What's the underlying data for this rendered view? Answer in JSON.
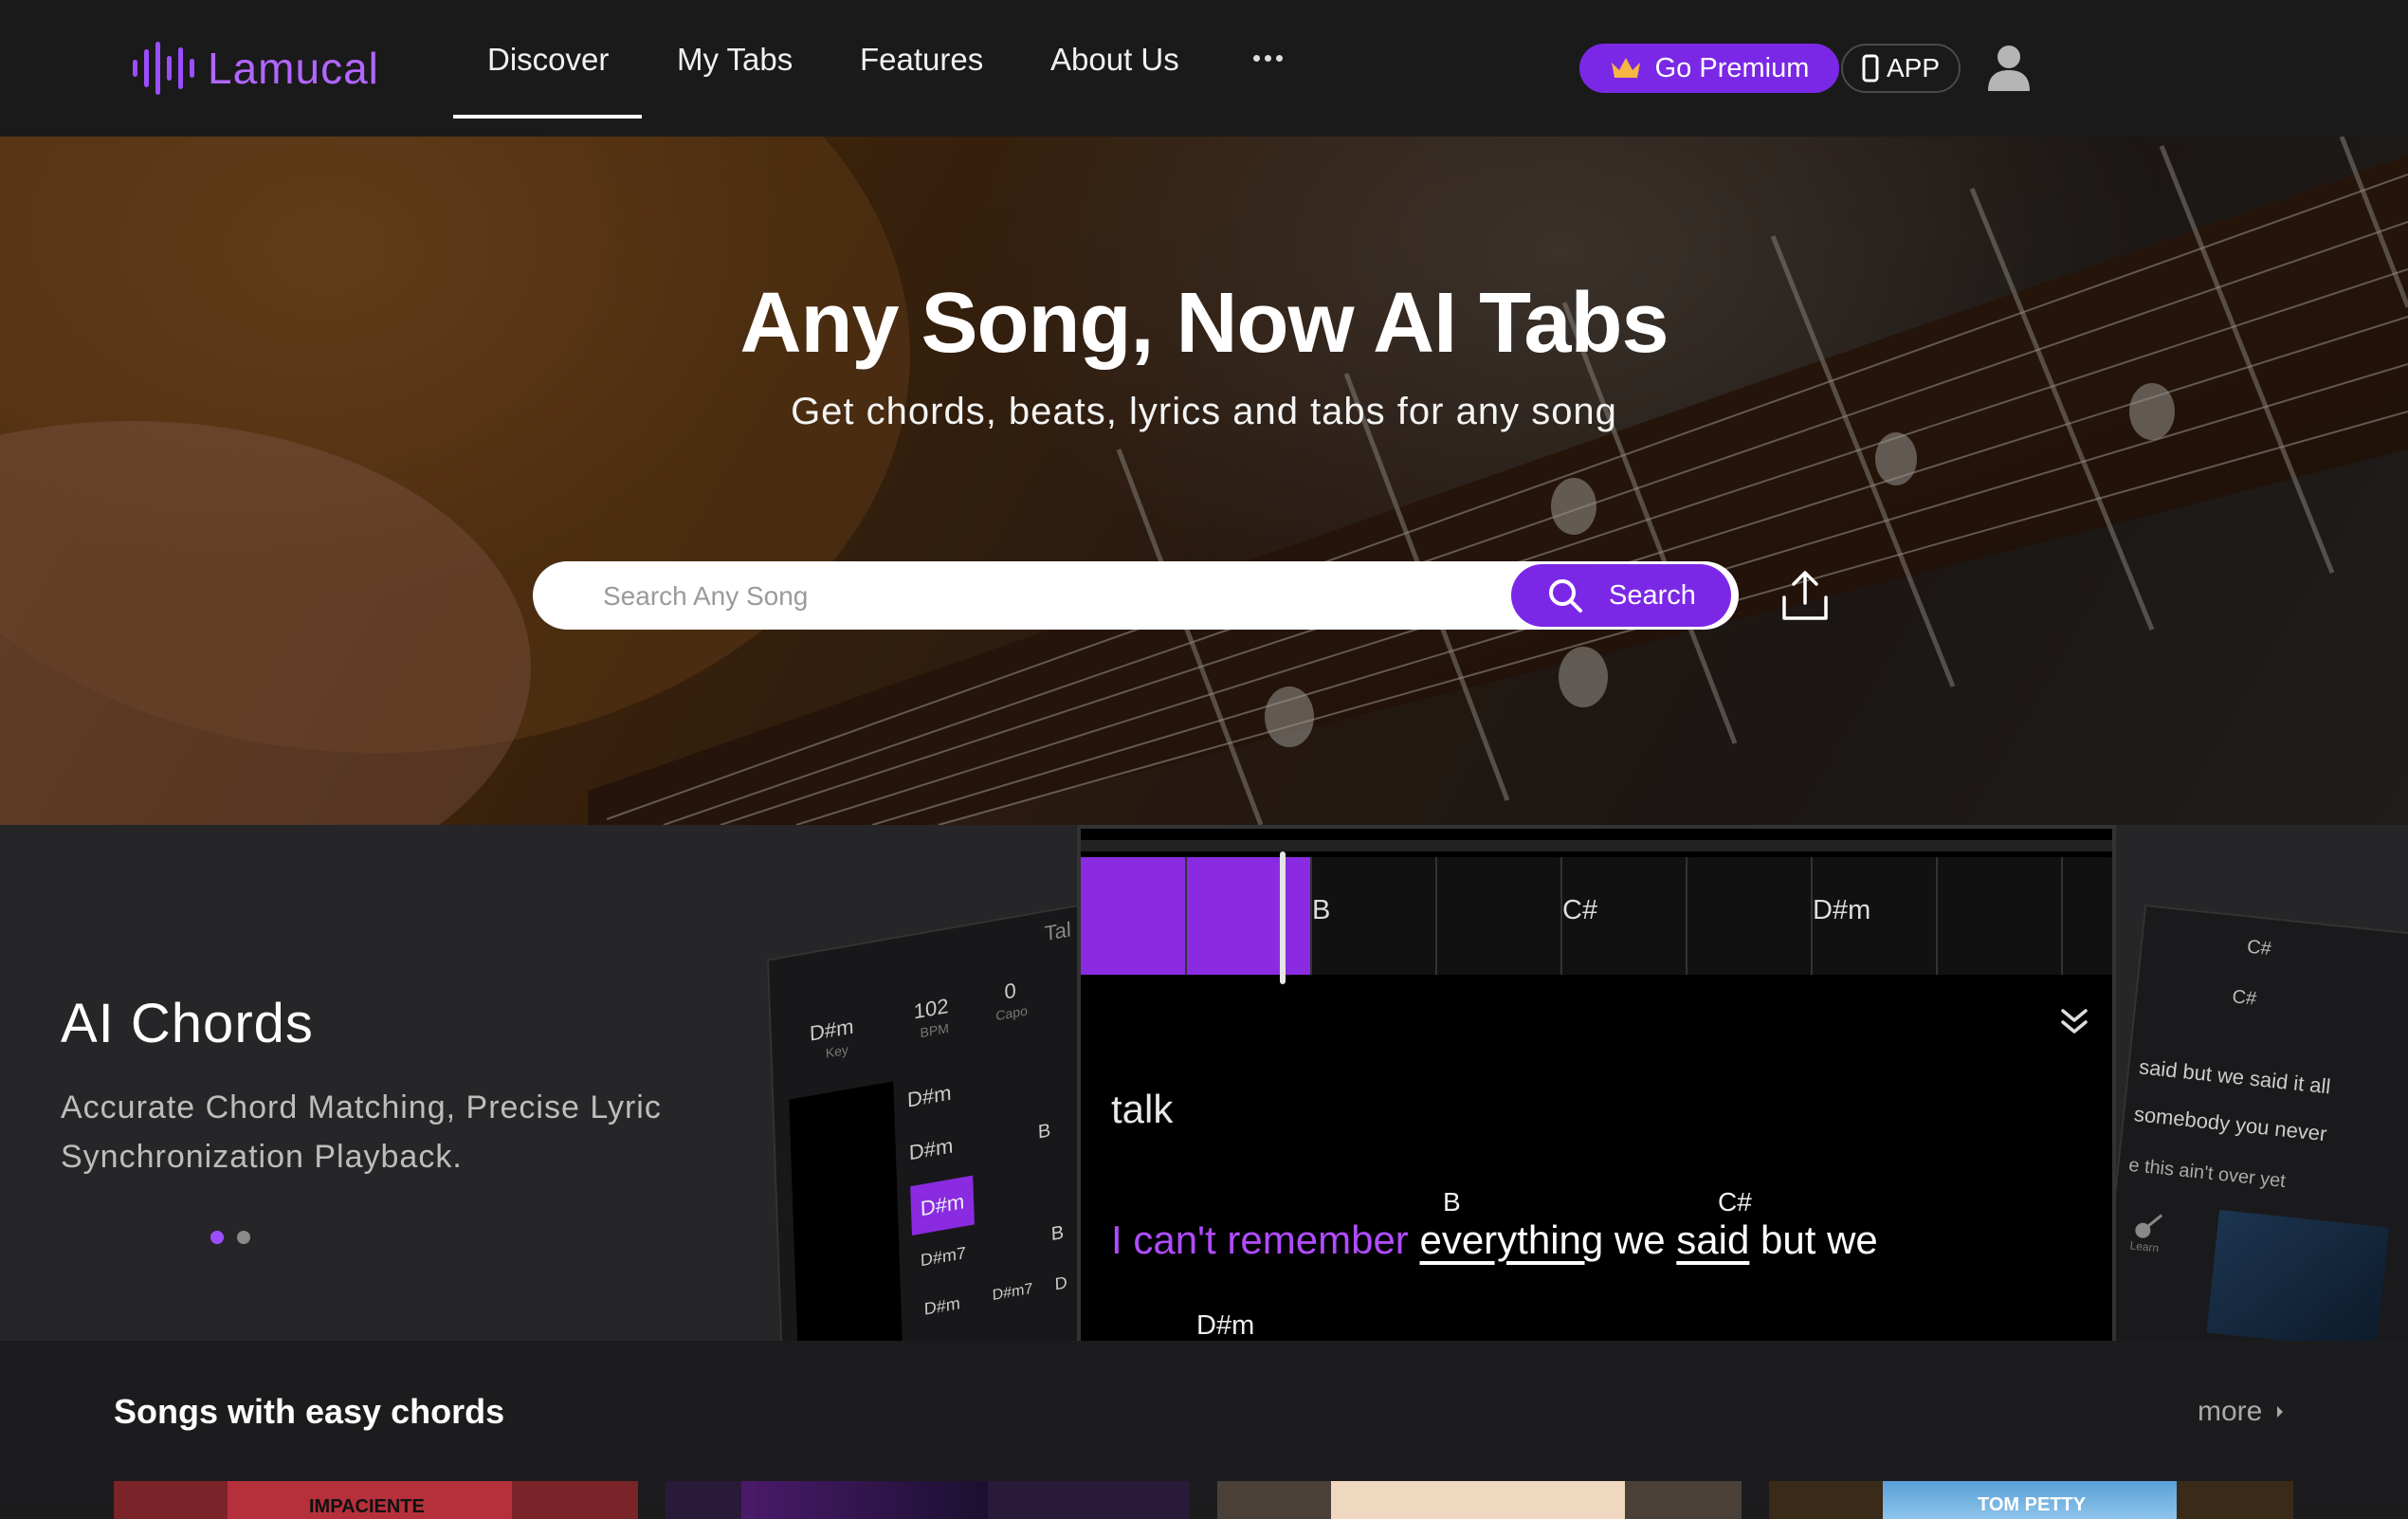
{
  "nav": {
    "logo": "Lamucal",
    "links": [
      "Discover",
      "My Tabs",
      "Features",
      "About Us"
    ],
    "premium_label": "Go Premium",
    "app_label": "APP"
  },
  "hero": {
    "title": "Any Song, Now AI Tabs",
    "subtitle": "Get chords, beats, lyrics and tabs for any song",
    "search_placeholder": "Search Any Song",
    "search_button": "Search"
  },
  "feature": {
    "title": "AI Chords",
    "description": "Accurate Chord Matching, Precise Lyric Synchronization Playback.",
    "slide_count": 2,
    "active_slide": 1,
    "player": {
      "chords": [
        "B",
        "C#",
        "D#m"
      ],
      "lyric_prev": "talk",
      "lyric_sung": "I can't remember",
      "lyric_words": [
        "everything",
        "we",
        "said",
        "but we"
      ],
      "chord_over_everything": "B",
      "chord_over_said": "C#",
      "next_chord": "D#m"
    },
    "left_card": {
      "key": "D#m",
      "key_label": "Key",
      "bpm": "102",
      "bpm_label": "BPM",
      "capo": "0",
      "capo_label": "Capo",
      "header": "Tal",
      "chords": [
        "D#m",
        "D#m",
        "D#m",
        "D#m7",
        "D#m",
        "D#m7",
        "D"
      ],
      "extra": [
        "B",
        "B"
      ]
    },
    "right_card": {
      "chords": [
        "C#",
        "C#"
      ],
      "lines": [
        "said but we said it all",
        "somebody you never",
        "e this ain't over yet"
      ],
      "learn_label": "Learn"
    }
  },
  "songs": {
    "title": "Songs with easy chords",
    "more_label": "more",
    "thumbs": [
      "IMPACIENTE",
      "",
      "",
      "TOM PETTY"
    ]
  },
  "colors": {
    "accent": "#7b28e6",
    "highlight": "#b04cff",
    "nav_bg": "#1a1a1b"
  }
}
